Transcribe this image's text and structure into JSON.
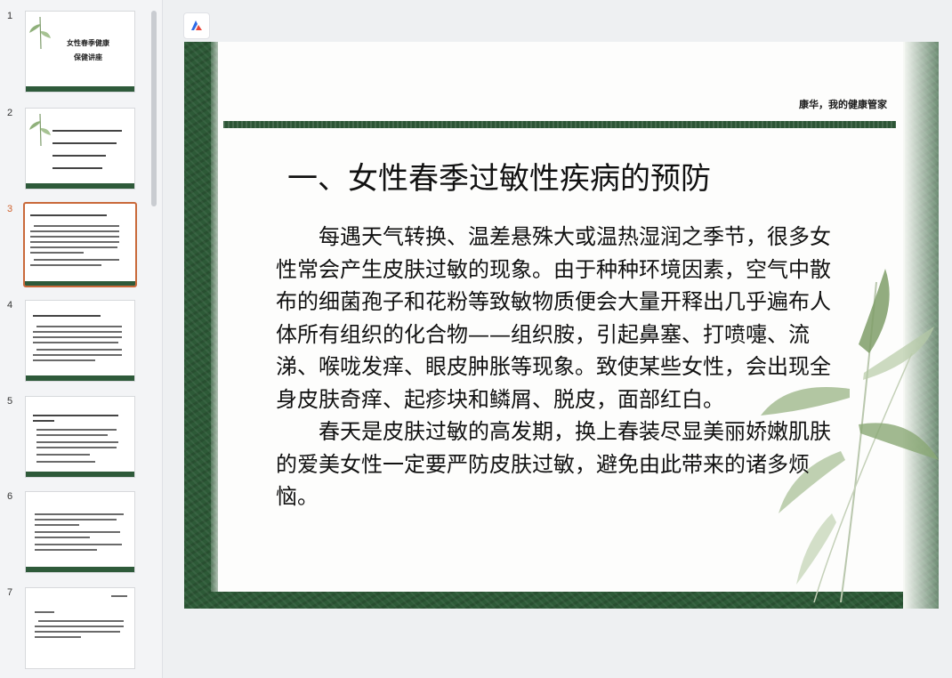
{
  "thumbnails": [
    {
      "number": "1",
      "title_lines": [
        "女性春季健康",
        "保健讲座"
      ]
    },
    {
      "number": "2"
    },
    {
      "number": "3",
      "selected": true
    },
    {
      "number": "4"
    },
    {
      "number": "5"
    },
    {
      "number": "6"
    },
    {
      "number": "7"
    }
  ],
  "slide": {
    "brand": "康华，我的健康管家",
    "title": "一、女性春季过敏性疾病的预防",
    "paragraphs": [
      "每遇天气转换、温差悬殊大或温热湿润之季节，很多女性常会产生皮肤过敏的现象。由于种种环境因素，空气中散布的细菌孢子和花粉等致敏物质便会大量开释出几乎遍布人体所有组织的化合物——组织胺，引起鼻塞、打喷嚏、流涕、喉咙发痒、眼皮肿胀等现象。致使某些女性，会出现全身皮肤奇痒、起疹块和鳞屑、脱皮，面部红白。",
      "春天是皮肤过敏的高发期，换上春装尽显美丽娇嫩肌肤的爱美女性一定要严防皮肤过敏，避免由此带来的诸多烦恼。"
    ]
  },
  "icons": {
    "app_logo": "app-logo-icon"
  },
  "colors": {
    "green_band": "#2c5535",
    "selected_border": "#c9693a",
    "selected_number": "#d0632f"
  }
}
